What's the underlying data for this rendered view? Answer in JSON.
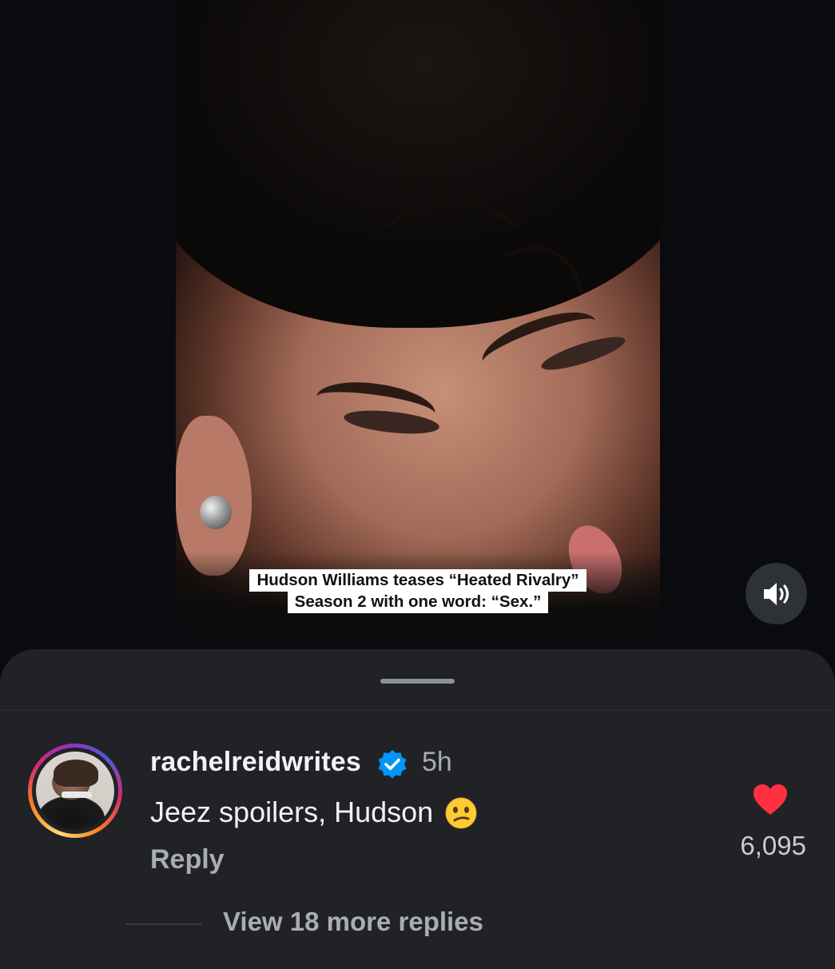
{
  "video": {
    "caption_line1": "Hudson Williams teases “Heated Rivalry”",
    "caption_line2": "Season 2 with one word: “Sex.”"
  },
  "sound_button": {
    "icon": "speaker-icon",
    "state": "sound-on"
  },
  "comment": {
    "username": "rachelreidwrites",
    "verified": true,
    "time": "5h",
    "text": "Jeez spoilers, Hudson",
    "emoji": "confused-face",
    "reply_label": "Reply",
    "likes": "6,095",
    "liked": true,
    "view_replies_label": "View 18 more replies"
  },
  "colors": {
    "background": "#090b0e",
    "sheet": "#202226",
    "heart": "#ff3040",
    "verified": "#0095f6"
  }
}
